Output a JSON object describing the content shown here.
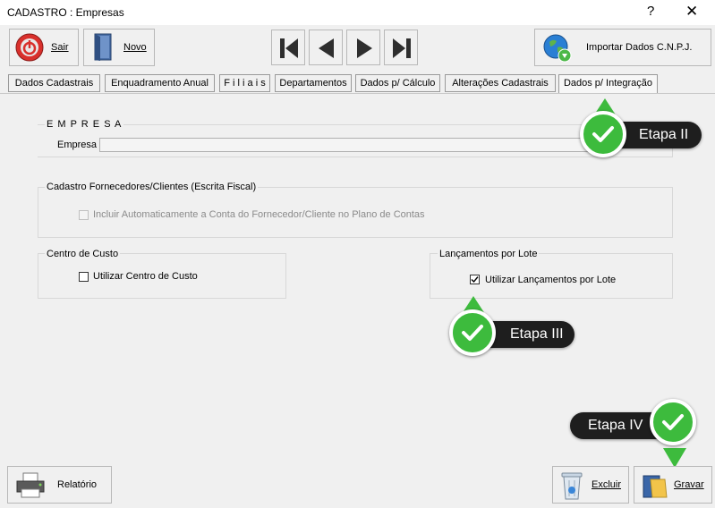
{
  "window": {
    "title": "CADASTRO : Empresas",
    "help": "?",
    "close": "✕"
  },
  "toolbar": {
    "sair": "Sair",
    "novo": "Novo",
    "importar": "Importar Dados C.N.P.J."
  },
  "tabs": [
    "Dados  Cadastrais",
    "Enquadramento Anual",
    "F i l i a i s",
    "Departamentos",
    "Dados p/ Cálculo",
    "Alterações Cadastrais",
    "Dados p/ Integração"
  ],
  "active_tab": "Dados p/ Integração",
  "empresa": {
    "group_label": "E M P R E S A",
    "field_label": "Empresa",
    "value": ""
  },
  "fornecedores": {
    "group_label": "Cadastro Fornecedores/Clientes (Escrita Fiscal)",
    "checkbox_label": "Incluir Automaticamente a Conta do Fornecedor/Cliente no Plano de Contas",
    "checked": false,
    "enabled": false
  },
  "centro_custo": {
    "group_label": "Centro de Custo",
    "checkbox_label": "Utilizar Centro de Custo",
    "checked": false
  },
  "lotes": {
    "group_label": "Lançamentos por Lote",
    "checkbox_label": "Utilizar Lançamentos por Lote",
    "checked": true
  },
  "callouts": {
    "etapa2": "Etapa II",
    "etapa3": "Etapa III",
    "etapa4": "Etapa IV"
  },
  "bottom": {
    "relatorio": "Relatório",
    "excluir": "Excluir",
    "gravar": "Gravar"
  },
  "colors": {
    "accent_green": "#3dbb3d",
    "callout_bg": "#1e1e1e"
  }
}
